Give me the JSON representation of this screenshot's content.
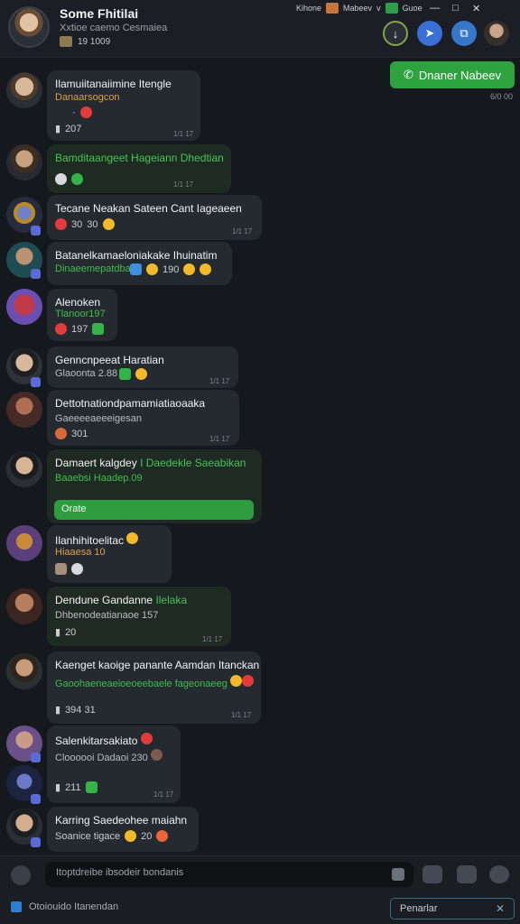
{
  "header": {
    "title": "Some Fhitilai",
    "subtitle": "Xxtioe caemo Cesmaiea",
    "meta": "19 1009",
    "tb_left": "Kihone",
    "tb_mid": "Mabeev",
    "tb_right": "Guoe",
    "caret": "v"
  },
  "pinned": {
    "label": "Dnaner Nabeev",
    "time": "6/0 00"
  },
  "messages": [
    {
      "name": "Ilamuiitanaiimine Itengle",
      "sub": "Danaarsogcon",
      "react": "",
      "ts": "1/1 17"
    },
    {
      "name": "Bamditaangeet Hageiann Dhedtian",
      "sub": "",
      "react": "",
      "ts": "1/1 17"
    },
    {
      "name": "Tecane Neakan Sateen Cant Iageaeen",
      "sub": "",
      "react": "30",
      "ts": "1/1 17"
    },
    {
      "name": "Batanelkamaeloniakake Ihuinatim",
      "sub": "Dinaeemepatdbaet",
      "react": "190",
      "ts": ""
    },
    {
      "name": "Alenoken",
      "sub": "Tlanoor197",
      "react": "197",
      "ts": ""
    },
    {
      "name": "Genncnpeeat Haratian",
      "sub": "Glaoonta 2.88",
      "react": "",
      "ts": "1/1 17"
    },
    {
      "name": "Dettotnationdpamamiatiaoaaka",
      "sub": "Gaeeeeaeeeigesan",
      "react": "301",
      "ts": "1/1 17"
    },
    {
      "name": "Damaert kalgdey",
      "name_hl": "I Daedekle Saeabikan",
      "sub": "Baaebsi Haadep.09",
      "cta": "Orate",
      "ts": ""
    },
    {
      "name": "Ilanhihitoelitac",
      "sub": "Hiaaesa 10",
      "react": "",
      "ts": ""
    },
    {
      "name": "Dendune Gandanne",
      "name_hl": "Ilelaka",
      "sub": "Dhbenodeatianaoe 157",
      "react": "20",
      "ts": "1/1 17"
    },
    {
      "name": "Kaenget kaoige panante Aamdan Itanckan",
      "sub": "Gaoohaeneaeioeoeebaele fageonaeeg",
      "react": "394 31",
      "ts": "1/1 17"
    },
    {
      "name": "Salenkitarsakiato",
      "sub": "Cloooooi Dadaoi 230",
      "react": "211",
      "ts": "1/1 17"
    },
    {
      "name": "Karring Saedeohee maiahn",
      "sub": "Soanice tigace",
      "react": "20",
      "ts": ""
    }
  ],
  "composer": {
    "placeholder": "Itoptdreibe ibsodeir bondanis",
    "status": "Otoiouido Itanendan",
    "right_label": "Penarlar",
    "right_icon": "close-icon"
  },
  "colors": {
    "accent": "#2da23f",
    "bg": "#15181d",
    "bubble": "#252930"
  }
}
